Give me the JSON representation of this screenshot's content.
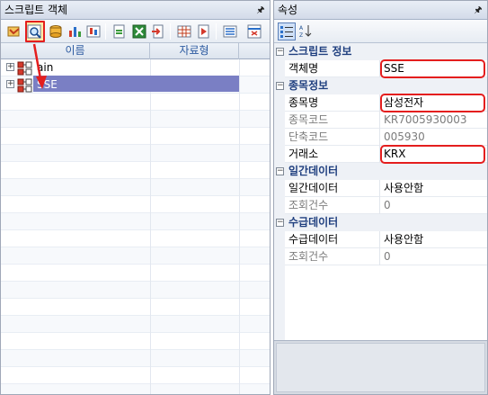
{
  "left_panel": {
    "title": "스크립트 객체",
    "pin_glyph": "ᆑ",
    "toolbar": {
      "buttons": [
        "open-icon",
        "find-object-icon",
        "database-icon",
        "chart-icon",
        "candle-icon",
        "add-script-icon",
        "excel-icon",
        "export-icon",
        "grid-icon",
        "run-icon",
        "list-icon",
        "calendar-icon",
        "table-icon",
        "close-icon"
      ]
    },
    "columns": [
      "이름",
      "자료형"
    ],
    "tree": [
      {
        "label": "Main",
        "display": "ain",
        "expander": "+"
      },
      {
        "label": "SSE",
        "display": "SSE",
        "expander": "+",
        "selected": true
      }
    ]
  },
  "right_panel": {
    "title": "속성",
    "pin_glyph": "ᆑ",
    "toolbar": [
      "categorized-view-icon",
      "alphabetical-view-icon"
    ],
    "categories": [
      {
        "label": "스크립트 정보",
        "toggle": "−",
        "props": [
          {
            "name": "객체명",
            "value": "SSE",
            "dim": false,
            "highlight": true
          }
        ]
      },
      {
        "label": "종목정보",
        "toggle": "−",
        "props": [
          {
            "name": "종목명",
            "value": "삼성전자",
            "dim": false,
            "highlight": true
          },
          {
            "name": "종목코드",
            "value": "KR7005930003",
            "dim": true,
            "highlight": false
          },
          {
            "name": "단축코드",
            "value": "005930",
            "dim": true,
            "highlight": false
          },
          {
            "name": "거래소",
            "value": "KRX",
            "dim": false,
            "highlight": true
          }
        ]
      },
      {
        "label": "일간데이터",
        "toggle": "−",
        "props": [
          {
            "name": "일간데이터",
            "value": "사용안함",
            "dim": false,
            "highlight": false
          },
          {
            "name": "조회건수",
            "value": "0",
            "dim": true,
            "highlight": false
          }
        ]
      },
      {
        "label": "수급데이터",
        "toggle": "−",
        "props": [
          {
            "name": "수급데이터",
            "value": "사용안함",
            "dim": false,
            "highlight": false
          },
          {
            "name": "조회건수",
            "value": "0",
            "dim": true,
            "highlight": false
          }
        ]
      }
    ]
  },
  "colors": {
    "highlight_red": "#e41e1e",
    "selection": "#7a7fc4",
    "category_text": "#1f3f7f",
    "header_text": "#2c5aa0"
  }
}
